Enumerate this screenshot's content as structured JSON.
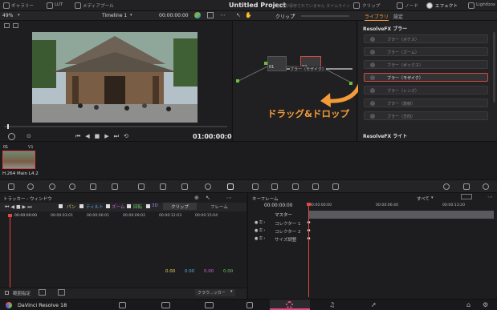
{
  "topbar": {
    "items": [
      "ギャラリー",
      "LUT",
      "メディアプール"
    ],
    "project_title": "Untitled Project",
    "project_subtitle": "変更が保存されていません",
    "timeline_label": "タイムライン",
    "right_items": [
      "クリップ",
      "ノード",
      "エフェクト",
      "Lightbox"
    ]
  },
  "viewer": {
    "zoom": "49%",
    "timeline_name": "Timeline 1",
    "timecode_top": "00:00:00:00",
    "timecode": "01:00:00:00"
  },
  "node_editor": {
    "mode": "クリップ",
    "nodes": [
      "01",
      "02"
    ],
    "node_label": "ブラー（モザイク）"
  },
  "library": {
    "tabs": [
      "ライブラリ",
      "設定"
    ],
    "section1": "ResolveFX ブラー",
    "effects": [
      "ブラー（ボケス）",
      "ブラー（ズーム）",
      "ブラー（ボックス）",
      "ブラー（モザイク）",
      "ブラー（レンズ）",
      "ブラー（放射）",
      "ブラー（方向）"
    ],
    "selected_index": 3,
    "section2": "ResolveFX ライト"
  },
  "overlay": {
    "drag_text": "ドラッグ&ドロップ"
  },
  "media": {
    "clip_index": "01",
    "track": "V1",
    "clip_name": "H.264 Main L4.2"
  },
  "tracker": {
    "title": "トラッカー - ウィンドウ",
    "toggles": [
      "パン",
      "ティルト",
      "ズーム",
      "回転",
      "3D"
    ],
    "mode_tabs": [
      "クリップ",
      "フレーム"
    ],
    "ruler": [
      "00:00:00:00",
      "00:00:03:01",
      "00:00:06:01",
      "00:00:09:02",
      "00:00:12:03",
      "00:00:15:04"
    ],
    "values": [
      "0.00",
      "0.00",
      "0.00",
      "0.00"
    ],
    "footer_check": "範囲指定",
    "footer_select": "クラウ...ッカー"
  },
  "keyframes": {
    "title": "キーフレーム",
    "filter": "すべて",
    "timecode": "00:00:00:00",
    "ruler": [
      "00:00:00:00",
      "00:00:06:40",
      "00:00:13:20"
    ],
    "tracks": [
      "マスター",
      "コレクター 1",
      "コレクター 2",
      "サイズ調整"
    ]
  },
  "statusbar": {
    "app": "DaVinci Resolve 18"
  },
  "colors": {
    "accent": "#f39b38",
    "select": "#d7473f",
    "playhead": "#e2483f"
  }
}
